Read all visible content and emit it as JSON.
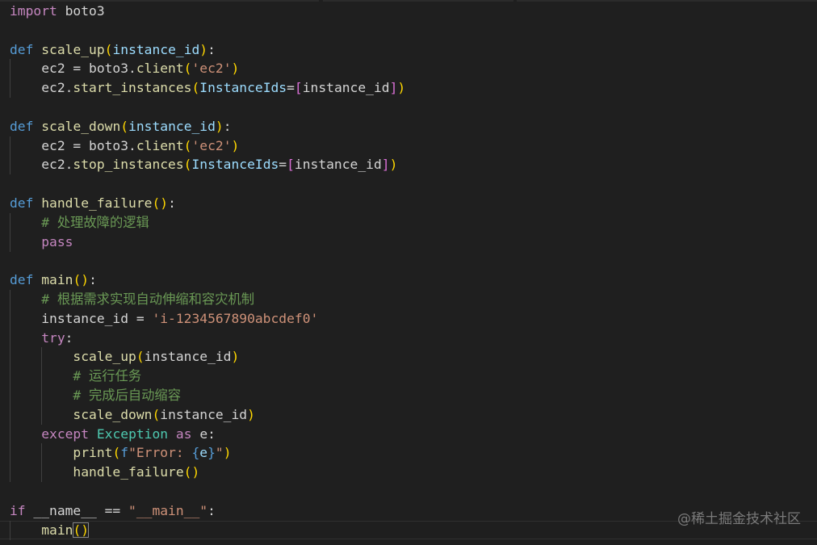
{
  "editor": {
    "lines": [
      [
        {
          "t": "import",
          "c": "kw-flow"
        },
        {
          "t": " boto3",
          "c": "var"
        }
      ],
      [],
      [
        {
          "t": "def",
          "c": "kw-def"
        },
        {
          "t": " ",
          "c": "var"
        },
        {
          "t": "scale_up",
          "c": "fn"
        },
        {
          "t": "(",
          "c": "p1"
        },
        {
          "t": "instance_id",
          "c": "param"
        },
        {
          "t": ")",
          "c": "p1"
        },
        {
          "t": ":",
          "c": "op"
        }
      ],
      [
        {
          "t": "    ec2 = boto3.",
          "c": "var"
        },
        {
          "t": "client",
          "c": "fn"
        },
        {
          "t": "(",
          "c": "p1"
        },
        {
          "t": "'ec2'",
          "c": "str"
        },
        {
          "t": ")",
          "c": "p1"
        }
      ],
      [
        {
          "t": "    ec2.",
          "c": "var"
        },
        {
          "t": "start_instances",
          "c": "fn"
        },
        {
          "t": "(",
          "c": "p1"
        },
        {
          "t": "InstanceIds",
          "c": "param"
        },
        {
          "t": "=",
          "c": "op"
        },
        {
          "t": "[",
          "c": "p2"
        },
        {
          "t": "instance_id",
          "c": "var"
        },
        {
          "t": "]",
          "c": "p2"
        },
        {
          "t": ")",
          "c": "p1"
        }
      ],
      [],
      [
        {
          "t": "def",
          "c": "kw-def"
        },
        {
          "t": " ",
          "c": "var"
        },
        {
          "t": "scale_down",
          "c": "fn"
        },
        {
          "t": "(",
          "c": "p1"
        },
        {
          "t": "instance_id",
          "c": "param"
        },
        {
          "t": ")",
          "c": "p1"
        },
        {
          "t": ":",
          "c": "op"
        }
      ],
      [
        {
          "t": "    ec2 = boto3.",
          "c": "var"
        },
        {
          "t": "client",
          "c": "fn"
        },
        {
          "t": "(",
          "c": "p1"
        },
        {
          "t": "'ec2'",
          "c": "str"
        },
        {
          "t": ")",
          "c": "p1"
        }
      ],
      [
        {
          "t": "    ec2.",
          "c": "var"
        },
        {
          "t": "stop_instances",
          "c": "fn"
        },
        {
          "t": "(",
          "c": "p1"
        },
        {
          "t": "InstanceIds",
          "c": "param"
        },
        {
          "t": "=",
          "c": "op"
        },
        {
          "t": "[",
          "c": "p2"
        },
        {
          "t": "instance_id",
          "c": "var"
        },
        {
          "t": "]",
          "c": "p2"
        },
        {
          "t": ")",
          "c": "p1"
        }
      ],
      [],
      [
        {
          "t": "def",
          "c": "kw-def"
        },
        {
          "t": " ",
          "c": "var"
        },
        {
          "t": "handle_failure",
          "c": "fn"
        },
        {
          "t": "()",
          "c": "p1"
        },
        {
          "t": ":",
          "c": "op"
        }
      ],
      [
        {
          "t": "    ",
          "c": "var"
        },
        {
          "t": "# 处理故障的逻辑",
          "c": "cmt"
        }
      ],
      [
        {
          "t": "    ",
          "c": "var"
        },
        {
          "t": "pass",
          "c": "kw-flow"
        }
      ],
      [],
      [
        {
          "t": "def",
          "c": "kw-def"
        },
        {
          "t": " ",
          "c": "var"
        },
        {
          "t": "main",
          "c": "fn"
        },
        {
          "t": "()",
          "c": "p1"
        },
        {
          "t": ":",
          "c": "op"
        }
      ],
      [
        {
          "t": "    ",
          "c": "var"
        },
        {
          "t": "# 根据需求实现自动伸缩和容灾机制",
          "c": "cmt"
        }
      ],
      [
        {
          "t": "    instance_id = ",
          "c": "var"
        },
        {
          "t": "'i-1234567890abcdef0'",
          "c": "str"
        }
      ],
      [
        {
          "t": "    ",
          "c": "var"
        },
        {
          "t": "try",
          "c": "kw-flow"
        },
        {
          "t": ":",
          "c": "op"
        }
      ],
      [
        {
          "t": "        ",
          "c": "var"
        },
        {
          "t": "scale_up",
          "c": "fn"
        },
        {
          "t": "(",
          "c": "p1"
        },
        {
          "t": "instance_id",
          "c": "var"
        },
        {
          "t": ")",
          "c": "p1"
        }
      ],
      [
        {
          "t": "        ",
          "c": "var"
        },
        {
          "t": "# 运行任务",
          "c": "cmt"
        }
      ],
      [
        {
          "t": "        ",
          "c": "var"
        },
        {
          "t": "# 完成后自动缩容",
          "c": "cmt"
        }
      ],
      [
        {
          "t": "        ",
          "c": "var"
        },
        {
          "t": "scale_down",
          "c": "fn"
        },
        {
          "t": "(",
          "c": "p1"
        },
        {
          "t": "instance_id",
          "c": "var"
        },
        {
          "t": ")",
          "c": "p1"
        }
      ],
      [
        {
          "t": "    ",
          "c": "var"
        },
        {
          "t": "except",
          "c": "kw-flow"
        },
        {
          "t": " ",
          "c": "var"
        },
        {
          "t": "Exception",
          "c": "cls"
        },
        {
          "t": " ",
          "c": "var"
        },
        {
          "t": "as",
          "c": "kw-flow"
        },
        {
          "t": " e:",
          "c": "var"
        }
      ],
      [
        {
          "t": "        ",
          "c": "var"
        },
        {
          "t": "print",
          "c": "fn"
        },
        {
          "t": "(",
          "c": "p1"
        },
        {
          "t": "f",
          "c": "kw-def"
        },
        {
          "t": "\"Error: ",
          "c": "str"
        },
        {
          "t": "{",
          "c": "kw-def"
        },
        {
          "t": "e",
          "c": "param"
        },
        {
          "t": "}",
          "c": "kw-def"
        },
        {
          "t": "\"",
          "c": "str"
        },
        {
          "t": ")",
          "c": "p1"
        }
      ],
      [
        {
          "t": "        ",
          "c": "var"
        },
        {
          "t": "handle_failure",
          "c": "fn"
        },
        {
          "t": "()",
          "c": "p1"
        }
      ],
      [],
      [
        {
          "t": "if",
          "c": "kw-flow"
        },
        {
          "t": " __name__ == ",
          "c": "var"
        },
        {
          "t": "\"__main__\"",
          "c": "str"
        },
        {
          "t": ":",
          "c": "op"
        }
      ],
      [
        {
          "t": "    ",
          "c": "var"
        },
        {
          "t": "main",
          "c": "fn"
        },
        {
          "t": "()",
          "c": "p1",
          "match": true
        }
      ]
    ],
    "current_line": 27
  },
  "watermark": {
    "text": "@稀土掘金技术社区"
  }
}
